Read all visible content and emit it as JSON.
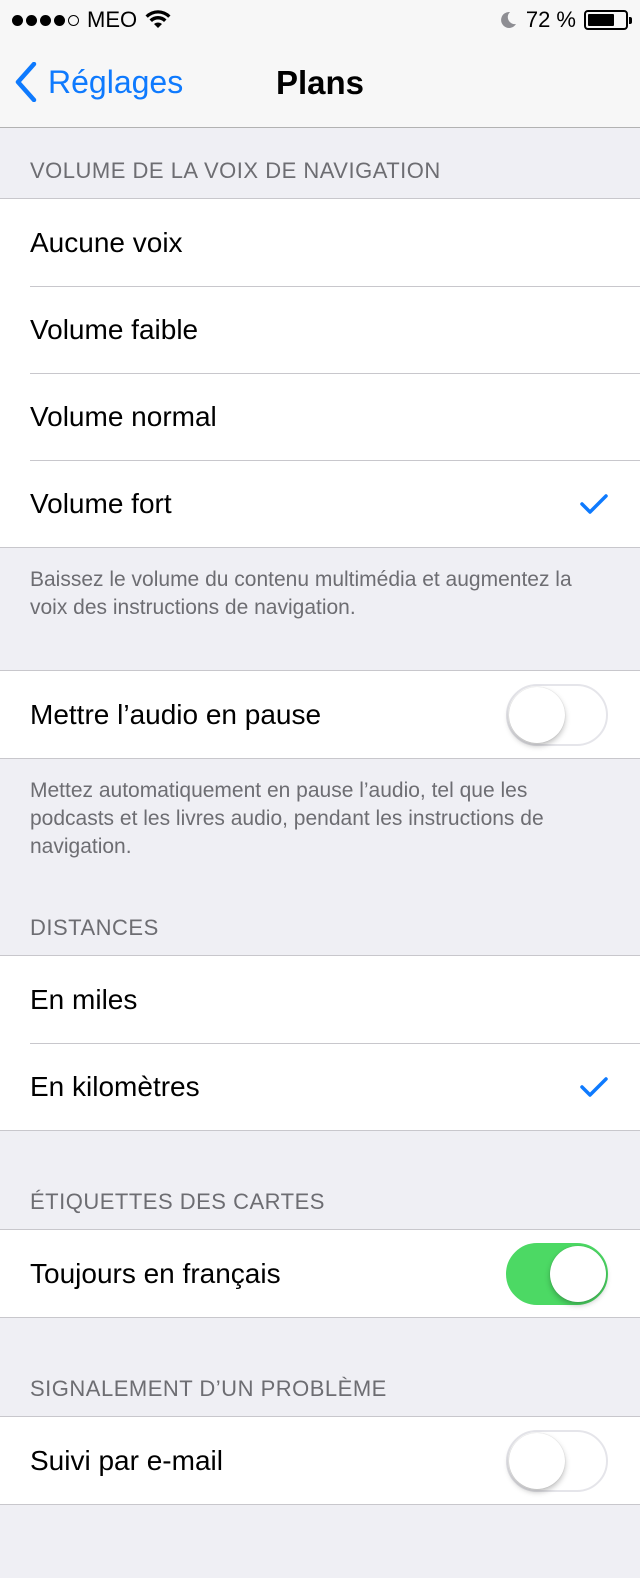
{
  "status": {
    "carrier": "MEO",
    "battery": "72 %",
    "battery_level": 0.72
  },
  "nav": {
    "back_label": "Réglages",
    "title": "Plans"
  },
  "voice_section": {
    "header": "VOLUME DE LA VOIX DE NAVIGATION",
    "items": [
      {
        "label": "Aucune voix",
        "checked": false
      },
      {
        "label": "Volume faible",
        "checked": false
      },
      {
        "label": "Volume normal",
        "checked": false
      },
      {
        "label": "Volume fort",
        "checked": true
      }
    ],
    "footer": "Baissez le volume du contenu multimédia et augmentez la voix des instructions de navigation."
  },
  "pause_section": {
    "label": "Mettre l’audio en pause",
    "toggle_on": false,
    "footer": "Mettez automatiquement en pause l’audio, tel que les podcasts et les livres audio, pendant les instructions de navigation."
  },
  "distance_section": {
    "header": "DISTANCES",
    "items": [
      {
        "label": "En miles",
        "checked": false
      },
      {
        "label": "En kilomètres",
        "checked": true
      }
    ]
  },
  "labels_section": {
    "header": "ÉTIQUETTES DES CARTES",
    "label": "Toujours en français",
    "toggle_on": true
  },
  "report_section": {
    "header": "SIGNALEMENT D’UN PROBLÈME",
    "label": "Suivi par e-mail",
    "toggle_on": false
  },
  "colors": {
    "accent": "#0e7afe",
    "toggle_on": "#4cd964",
    "background": "#efeff4",
    "secondary_text": "#6d6d72"
  }
}
